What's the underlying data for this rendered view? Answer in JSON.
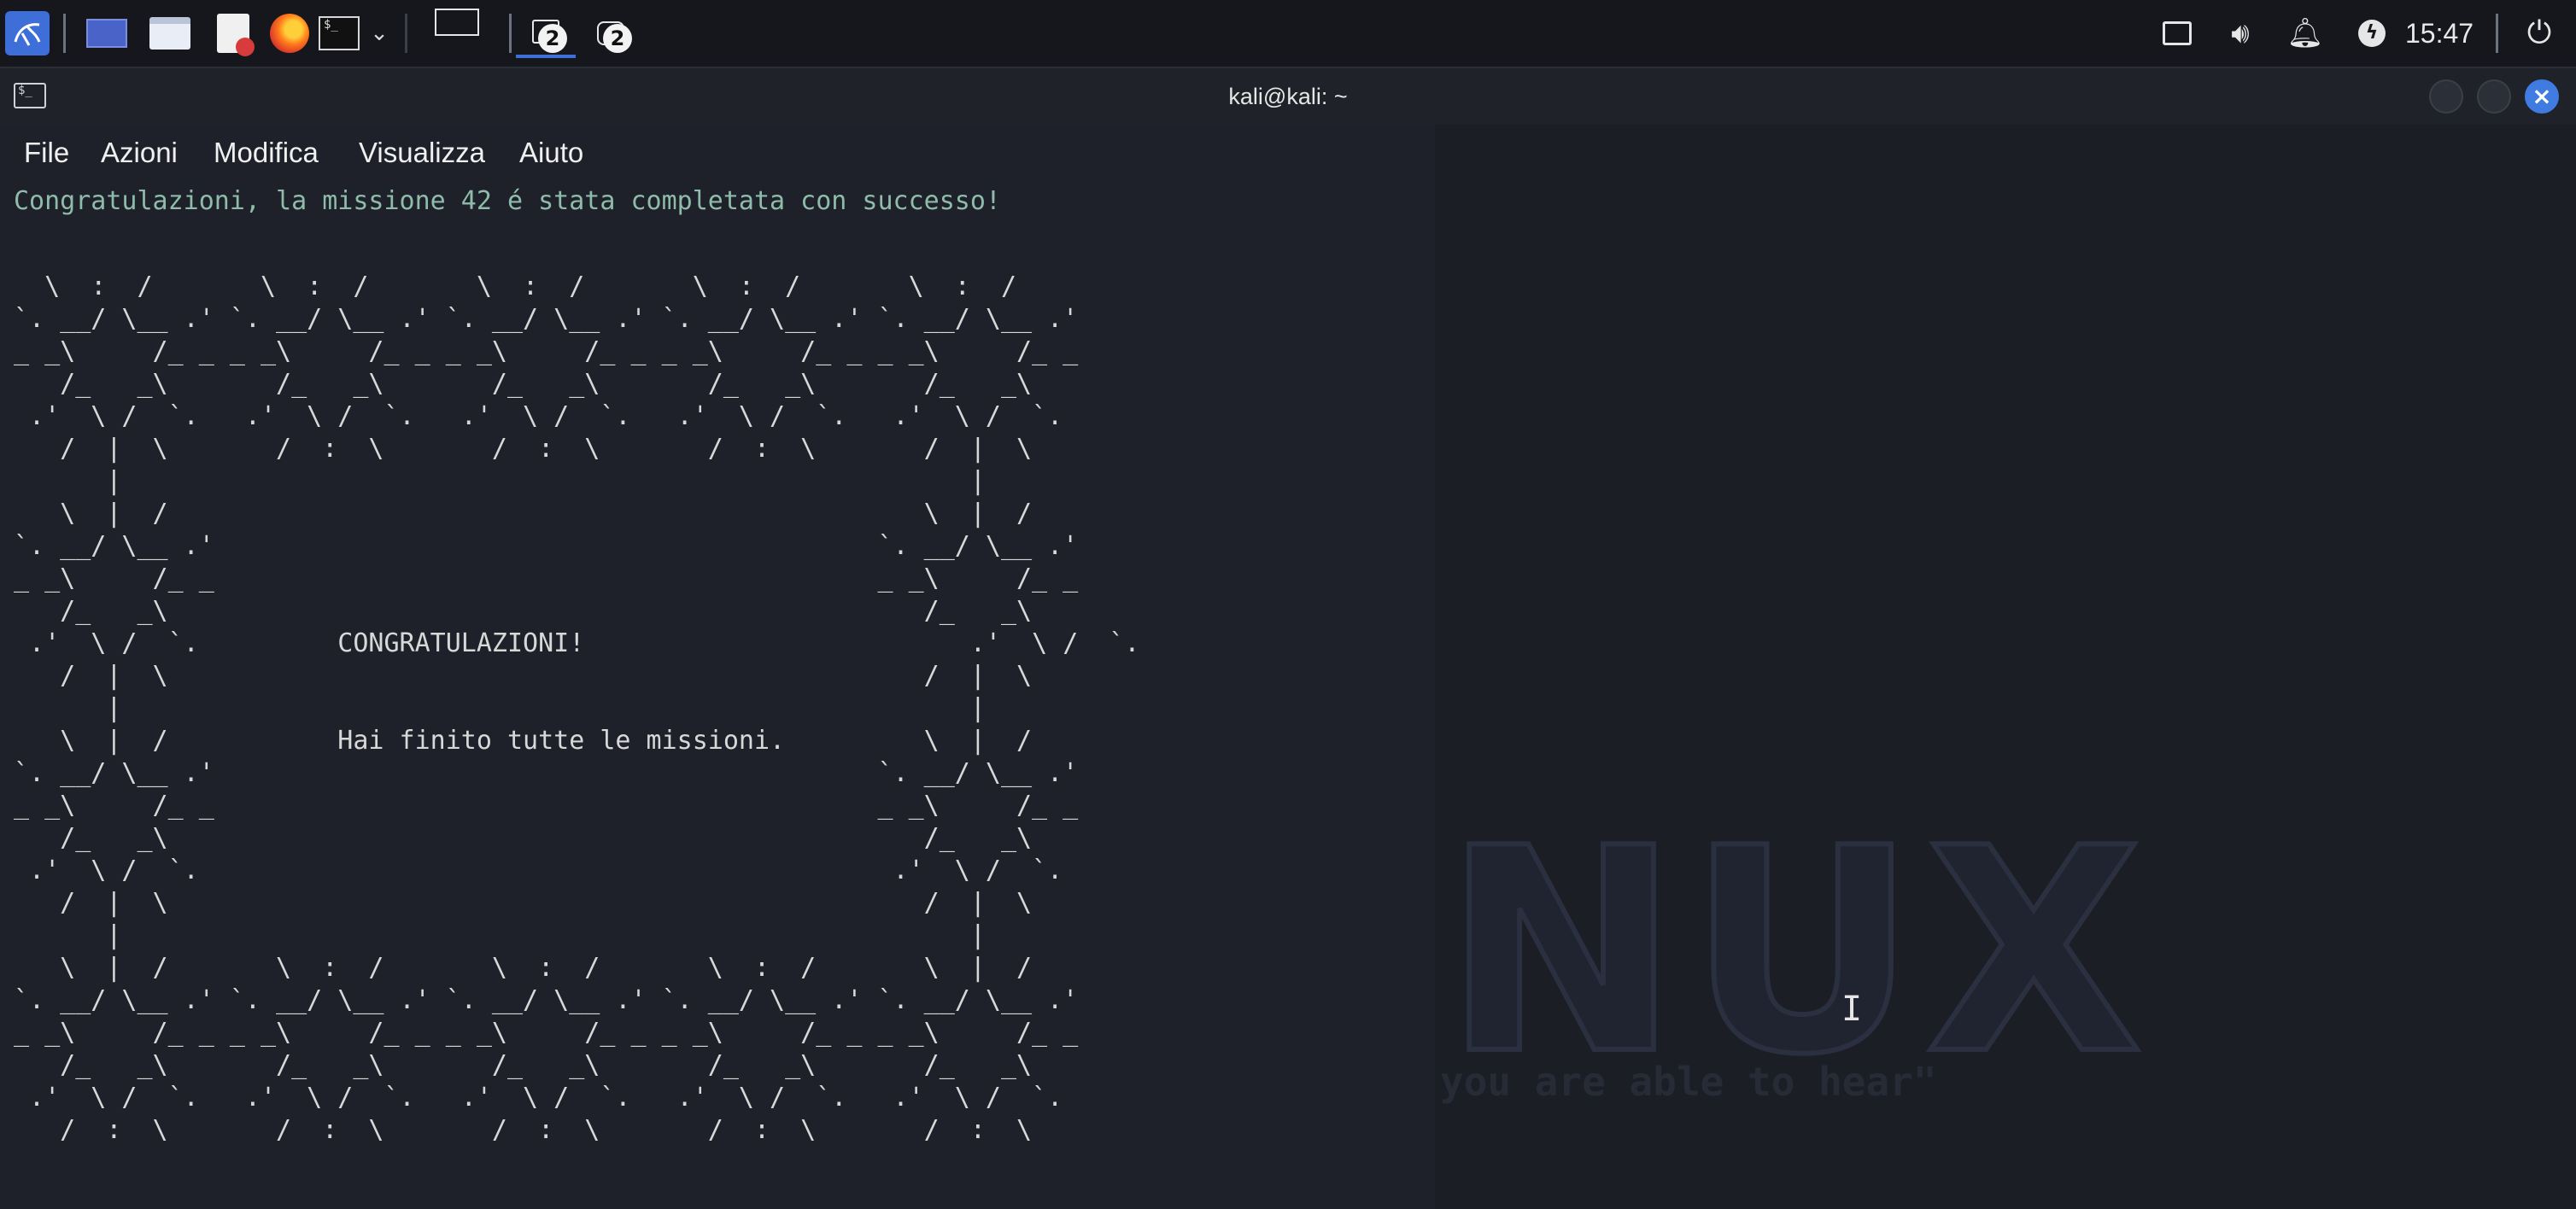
{
  "taskbar": {
    "clock": "15:47",
    "workspace_badges": [
      "2",
      "2"
    ],
    "launchers": [
      "kali-menu-icon",
      "desktop-icon",
      "file-manager-icon",
      "text-editor-icon",
      "firefox-icon",
      "terminal-icon",
      "dropdown-icon"
    ],
    "tray_icons": [
      "network-icon",
      "volume-icon",
      "notifications-icon",
      "power-manager-icon",
      "logout-icon"
    ]
  },
  "window": {
    "title": "kali@kali: ~"
  },
  "menu": {
    "file": "File",
    "actions": "Azioni",
    "edit": "Modifica",
    "view": "Visualizza",
    "help": "Aiuto"
  },
  "terminal": {
    "first_line": "Congratulazioni, la missione 42 é stata completata con successo!",
    "heading": "CONGRATULAZIONI!",
    "message": "Hai finito tutte le missioni."
  },
  "wallpaper": {
    "logo_text": "NUX",
    "quote": "you are able to hear\""
  },
  "colors": {
    "accent_blue": "#3e6fd8",
    "terminal_bg": "#1e2129",
    "success_text": "#8fbcaa"
  }
}
